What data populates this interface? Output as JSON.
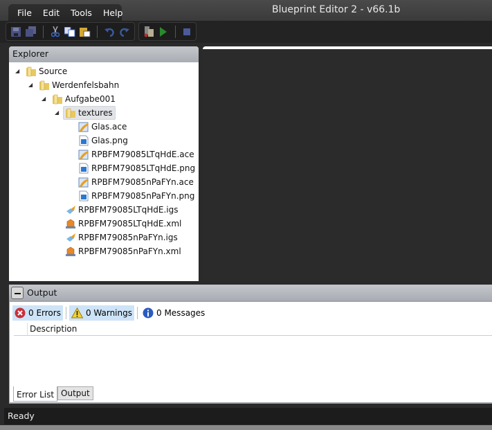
{
  "window": {
    "title": "Blueprint Editor 2 - v66.1b"
  },
  "menu": [
    "File",
    "Edit",
    "Tools",
    "Help"
  ],
  "toolbar": {
    "groups": [
      [
        "save-icon",
        "save-all-icon",
        "|",
        "cut-icon",
        "copy-icon",
        "paste-icon",
        "|",
        "undo-icon",
        "redo-icon"
      ],
      [
        "build-icon",
        "play-icon",
        "|",
        "stop-icon"
      ]
    ]
  },
  "explorer": {
    "title": "Explorer",
    "tree": [
      {
        "label": "Source",
        "type": "folder",
        "level": 0,
        "expanded": true
      },
      {
        "label": "Werdenfelsbahn",
        "type": "folder",
        "level": 1,
        "expanded": true
      },
      {
        "label": "Aufgabe001",
        "type": "folder",
        "level": 2,
        "expanded": true
      },
      {
        "label": "textures",
        "type": "folder",
        "level": 3,
        "expanded": true,
        "selected": true
      },
      {
        "label": "Glas.ace",
        "type": "ace",
        "level": 4
      },
      {
        "label": "Glas.png",
        "type": "png",
        "level": 4
      },
      {
        "label": "RPBFM79085LTqHdE.ace",
        "type": "ace",
        "level": 4
      },
      {
        "label": "RPBFM79085LTqHdE.png",
        "type": "png",
        "level": 4
      },
      {
        "label": "RPBFM79085nPaFYn.ace",
        "type": "ace",
        "level": 4
      },
      {
        "label": "RPBFM79085nPaFYn.png",
        "type": "png",
        "level": 4
      },
      {
        "label": "RPBFM79085LTqHdE.igs",
        "type": "igs",
        "level": 3
      },
      {
        "label": "RPBFM79085LTqHdE.xml",
        "type": "xml",
        "level": 3
      },
      {
        "label": "RPBFM79085nPaFYn.igs",
        "type": "igs",
        "level": 3
      },
      {
        "label": "RPBFM79085nPaFYn.xml",
        "type": "xml",
        "level": 3
      }
    ]
  },
  "output": {
    "title": "Output",
    "filters": {
      "errors": "0 Errors",
      "warnings": "0 Warnings",
      "messages": "0 Messages"
    },
    "column": "Description",
    "tabs": [
      "Error List",
      "Output"
    ]
  },
  "status": "Ready"
}
